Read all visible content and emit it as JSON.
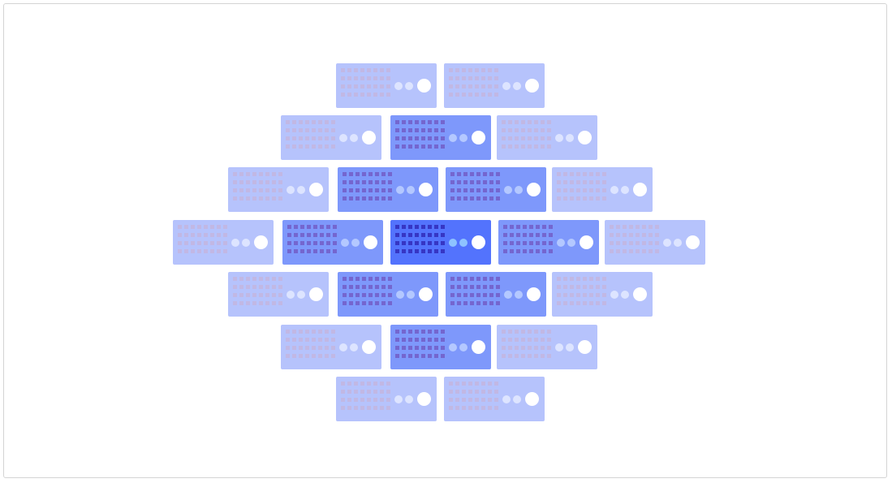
{
  "scene": {
    "colors": {
      "background": "#ffffff",
      "frame_border": "#d4d4d4",
      "tier_outer": "#b6c3fc",
      "tier_middle": "#7e98fb",
      "tier_center": "#5373fd"
    },
    "icon_motif": "server-rack-icon",
    "rows": [
      {
        "tiers": [
          0,
          0
        ]
      },
      {
        "tiers": [
          0,
          1,
          0
        ]
      },
      {
        "tiers": [
          0,
          1,
          1,
          0
        ]
      },
      {
        "tiers": [
          0,
          1,
          2,
          1,
          0
        ]
      },
      {
        "tiers": [
          0,
          1,
          1,
          0
        ]
      },
      {
        "tiers": [
          0,
          1,
          0
        ]
      },
      {
        "tiers": [
          0,
          0
        ]
      }
    ]
  }
}
